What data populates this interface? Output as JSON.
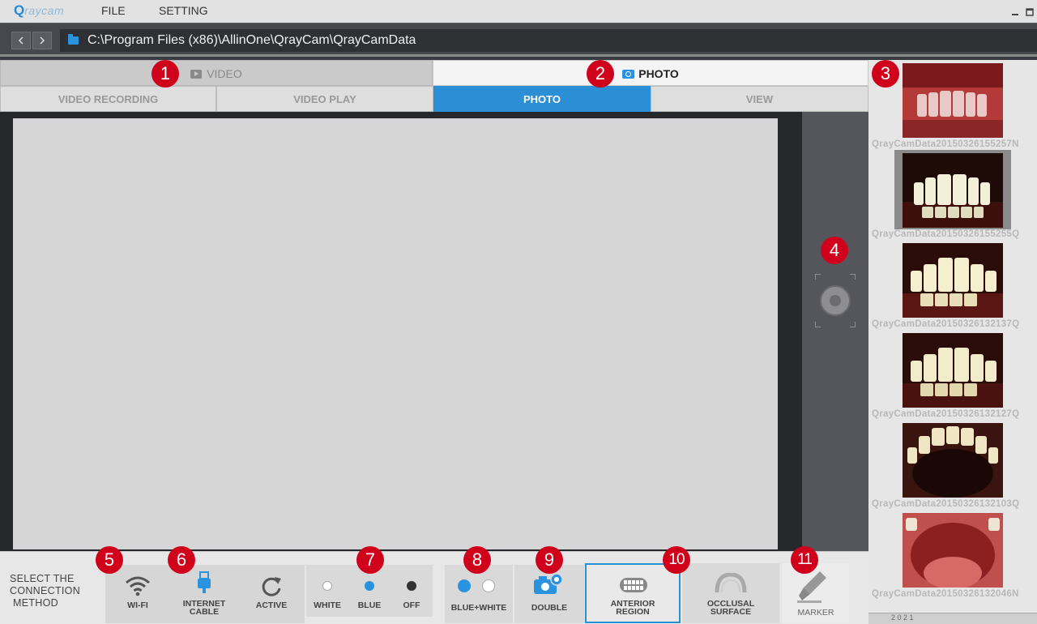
{
  "app": {
    "logo_q": "Q",
    "logo_rest": "raycam",
    "menu": [
      "FILE",
      "SETTING"
    ],
    "window_controls": [
      "minimize-icon",
      "maximize-icon"
    ]
  },
  "pathbar": {
    "back_icon": "chevron-left-icon",
    "forward_icon": "chevron-right-icon",
    "folder_icon": "folder-icon",
    "path": "C:\\Program Files (x86)\\AllinOne\\QrayCam\\QrayCamData"
  },
  "tabs": {
    "video": "VIDEO",
    "photo": "PHOTO",
    "active": "PHOTO"
  },
  "subtabs": {
    "items": [
      "VIDEO RECORDING",
      "VIDEO PLAY",
      "PHOTO",
      "VIEW"
    ],
    "active": "PHOTO"
  },
  "capture": {
    "icon": "shutter-icon"
  },
  "thumbnails": [
    {
      "caption": "QrayCamData20150326155257N",
      "color": "#7a1a1c"
    },
    {
      "caption": "QrayCamData20150326155255Q",
      "color": "#1e0b08",
      "selected": true
    },
    {
      "caption": "QrayCamData20150326132137Q",
      "color": "#2a0d08"
    },
    {
      "caption": "QrayCamData20150326132127Q",
      "color": "#2a0d08"
    },
    {
      "caption": "QrayCamData20150326132103Q",
      "color": "#3a140e"
    },
    {
      "caption": "QrayCamData20150326132046N",
      "color": "#c0504e"
    }
  ],
  "thumbs_bottom_text": "2 0 2 1",
  "toolbar": {
    "connection_label_line1": "SELECT THE",
    "connection_label_line2": "CONNECTION",
    "connection_label_line3": "METHOD",
    "wifi": "WI-FI",
    "internet_line1": "INTERNET",
    "internet_line2": "CABLE",
    "active": "ACTIVE",
    "white": "WHITE",
    "blue": "BLUE",
    "off": "OFF",
    "blue_white": "BLUE+WHITE",
    "double": "DOUBLE",
    "anterior_line1": "ANTERIOR",
    "anterior_line2": "REGION",
    "occlusal_line1": "OCCLUSAL",
    "occlusal_line2": "SURFACE",
    "marker": "MARKER"
  },
  "callouts": [
    "1",
    "2",
    "3",
    "4",
    "5",
    "6",
    "7",
    "8",
    "9",
    "10",
    "11"
  ],
  "colors": {
    "accent": "#2a8fd4",
    "callout": "#d0021b"
  }
}
